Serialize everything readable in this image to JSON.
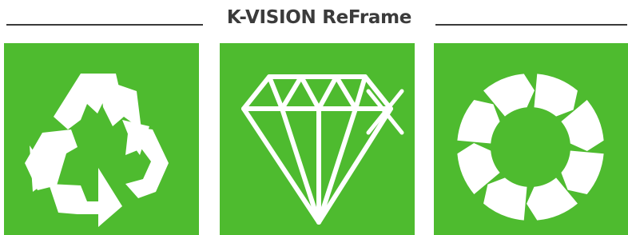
{
  "header": {
    "title": "K-VISION ReFrame"
  },
  "colors": {
    "tile_green": "#4ebb2f",
    "icon_white": "#ffffff",
    "title_text": "#3b3b3b",
    "rule": "#3a3a3a"
  },
  "tiles": [
    {
      "icon": "recycle-icon"
    },
    {
      "icon": "diamond-icon"
    },
    {
      "icon": "circular-arrows-icon"
    }
  ]
}
